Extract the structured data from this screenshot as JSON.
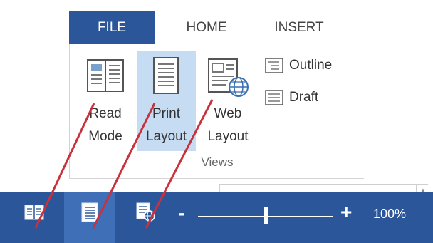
{
  "ribbon": {
    "tabs": [
      {
        "label": "FILE"
      },
      {
        "label": "HOME"
      },
      {
        "label": "INSERT"
      }
    ],
    "views_group": {
      "read_mode": {
        "line1": "Read",
        "line2": "Mode"
      },
      "print_layout": {
        "line1": "Print",
        "line2": "Layout"
      },
      "web_layout": {
        "line1": "Web",
        "line2": "Layout"
      },
      "outline": {
        "label": "Outline"
      },
      "draft": {
        "label": "Draft"
      },
      "label": "Views"
    }
  },
  "status_bar": {
    "zoom": {
      "minus": "-",
      "plus": "+",
      "level": "100%",
      "slider_fraction": 0.5
    },
    "icons": [
      "read-mode-icon",
      "print-layout-icon",
      "web-layout-icon"
    ]
  },
  "colors": {
    "accent": "#2b579a",
    "selected_view": "#c5dcf2",
    "callout_line": "#c8323c"
  }
}
